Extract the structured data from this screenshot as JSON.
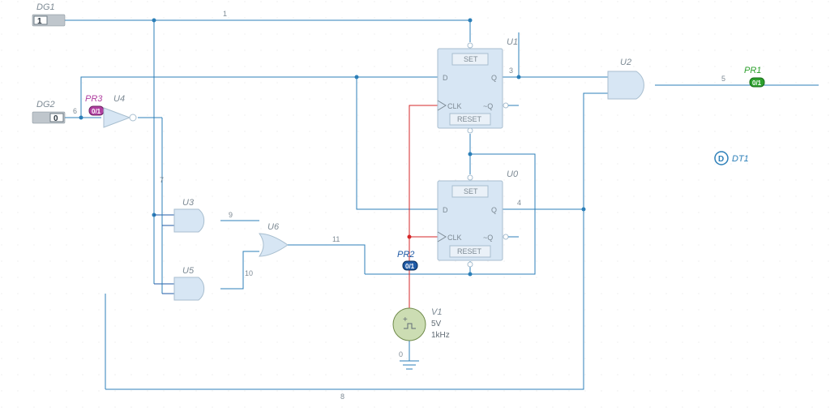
{
  "switches": {
    "dg1": {
      "label": "DG1",
      "value": "1"
    },
    "dg2": {
      "label": "DG2",
      "value": "0"
    }
  },
  "gates": {
    "u3": "U3",
    "u4": "U4",
    "u5": "U5",
    "u6": "U6",
    "u2": "U2"
  },
  "flipflops": {
    "u1": {
      "label": "U1",
      "set": "SET",
      "d": "D",
      "q": "Q",
      "clk": "CLK",
      "nq": "~Q",
      "reset": "RESET"
    },
    "u0": {
      "label": "U0",
      "set": "SET",
      "d": "D",
      "q": "Q",
      "clk": "CLK",
      "nq": "~Q",
      "reset": "RESET"
    }
  },
  "source": {
    "v1": {
      "label": "V1",
      "voltage": "5V",
      "freq": "1kHz"
    }
  },
  "probes": {
    "pr1": {
      "label": "PR1",
      "badge": "0/1"
    },
    "pr2": {
      "label": "PR2",
      "badge": "0/1"
    },
    "pr3": {
      "label": "PR3",
      "badge": "0/1"
    }
  },
  "dt1": {
    "label": "DT1",
    "letter": "D"
  },
  "nets": {
    "n1": "1",
    "n3": "3",
    "n4": "4",
    "n5": "5",
    "n6": "6",
    "n7": "7",
    "n8": "8",
    "n9": "9",
    "n10": "10",
    "n11": "11",
    "n0": "0"
  },
  "chart_data": {
    "type": "diagram",
    "description": "Digital logic schematic with two D flip-flops (U0, U1), AND gates (U2, U3, U5), NOT gate (U4), OR gate (U6), pulse voltage source V1 (5V, 1kHz), two toggle inputs DG1=1, DG2=0, probes PR1, PR2, PR3, and a datatip DT1.",
    "nodes": [
      "0",
      "1",
      "3",
      "4",
      "5",
      "6",
      "7",
      "8",
      "9",
      "10",
      "11"
    ],
    "components": [
      {
        "ref": "DG1",
        "type": "switch",
        "value": "1"
      },
      {
        "ref": "DG2",
        "type": "switch",
        "value": "0"
      },
      {
        "ref": "U4",
        "type": "NOT"
      },
      {
        "ref": "U3",
        "type": "AND2"
      },
      {
        "ref": "U5",
        "type": "AND2"
      },
      {
        "ref": "U6",
        "type": "OR2"
      },
      {
        "ref": "U2",
        "type": "AND2"
      },
      {
        "ref": "U1",
        "type": "DFF_SR"
      },
      {
        "ref": "U0",
        "type": "DFF_SR"
      },
      {
        "ref": "V1",
        "type": "Vpulse",
        "params": {
          "V": "5V",
          "f": "1kHz"
        }
      },
      {
        "ref": "PR1",
        "type": "probe"
      },
      {
        "ref": "PR2",
        "type": "probe"
      },
      {
        "ref": "PR3",
        "type": "probe"
      },
      {
        "ref": "DT1",
        "type": "datatip"
      }
    ]
  }
}
